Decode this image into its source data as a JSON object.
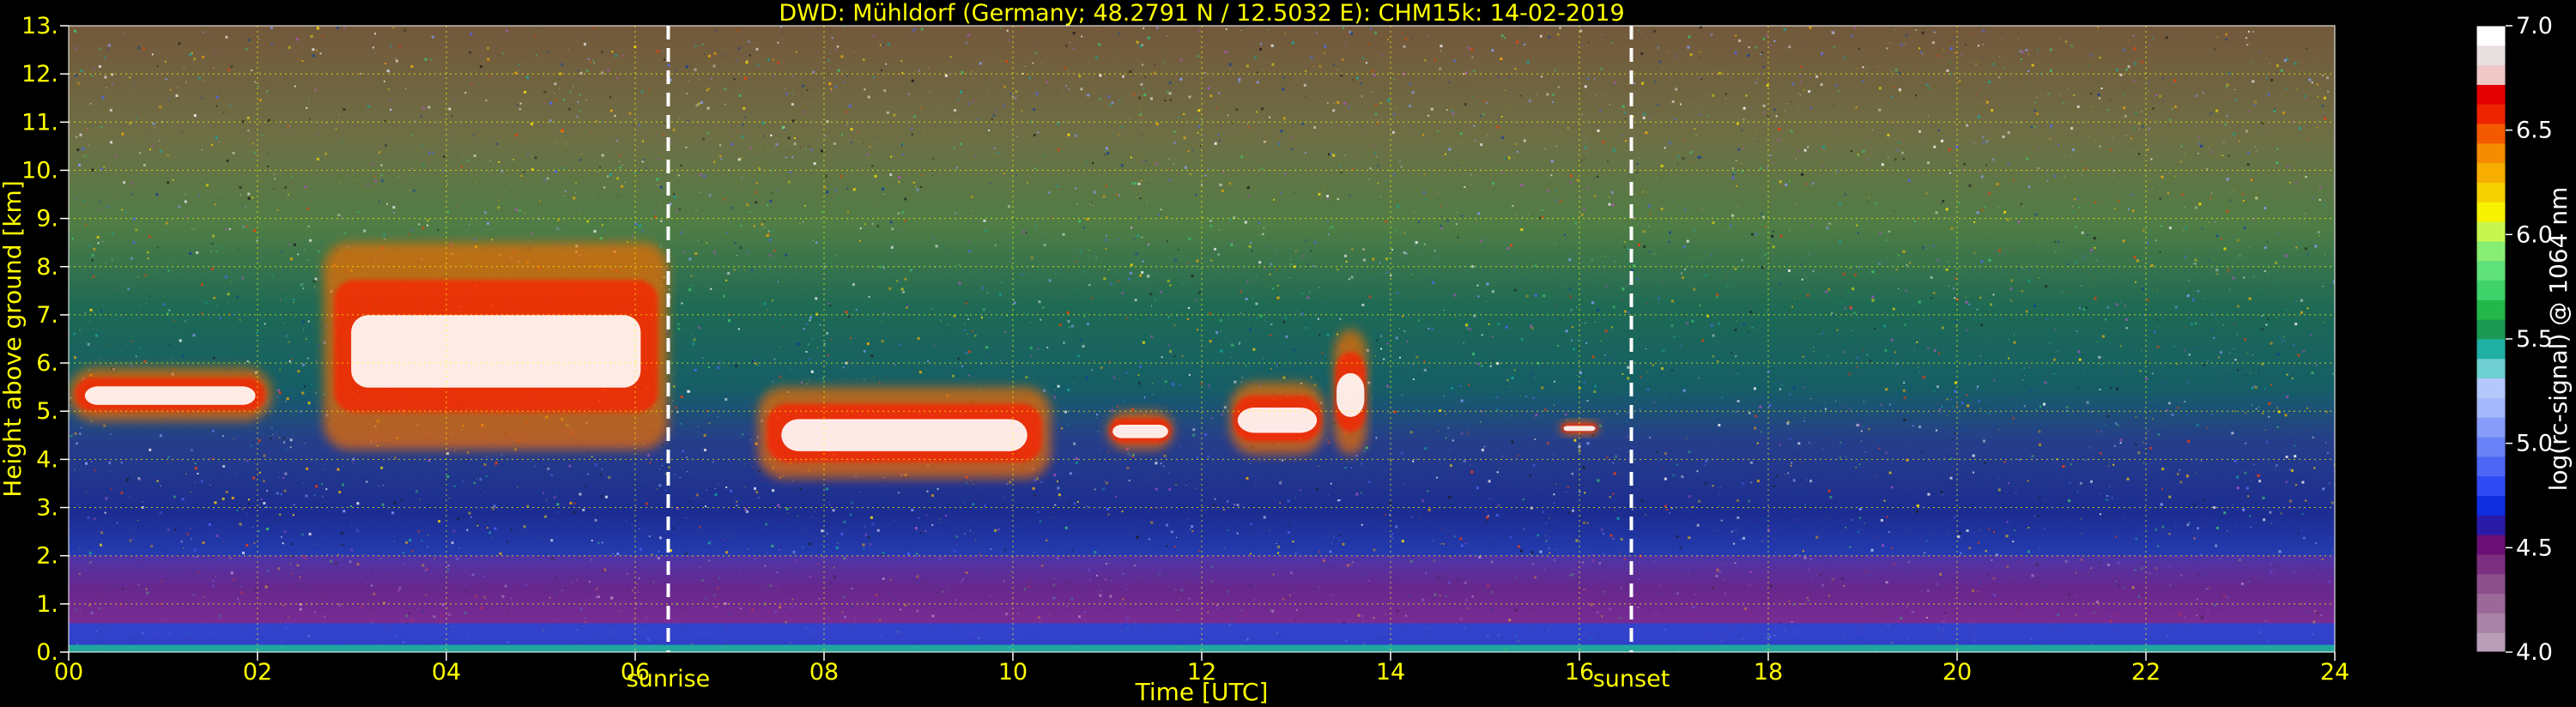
{
  "chart_data": {
    "type": "heatmap",
    "title": "DWD: Mühldorf (Germany; 48.2791 N / 12.5032 E):    CHM15k: 14-02-2019",
    "xlabel": "Time [UTC]",
    "ylabel": "Height above ground [km]",
    "xlim": [
      0,
      24
    ],
    "ylim": [
      0,
      13
    ],
    "x_ticks": [
      {
        "value": 0,
        "label": "00"
      },
      {
        "value": 2,
        "label": "02"
      },
      {
        "value": 4,
        "label": "04"
      },
      {
        "value": 6,
        "label": "06"
      },
      {
        "value": 8,
        "label": "08"
      },
      {
        "value": 10,
        "label": "10"
      },
      {
        "value": 12,
        "label": "12"
      },
      {
        "value": 14,
        "label": "14"
      },
      {
        "value": 16,
        "label": "16"
      },
      {
        "value": 18,
        "label": "18"
      },
      {
        "value": 20,
        "label": "20"
      },
      {
        "value": 22,
        "label": "22"
      },
      {
        "value": 24,
        "label": "24"
      }
    ],
    "y_ticks": [
      {
        "value": 0,
        "label": "0."
      },
      {
        "value": 1,
        "label": "1."
      },
      {
        "value": 2,
        "label": "2."
      },
      {
        "value": 3,
        "label": "3."
      },
      {
        "value": 4,
        "label": "4."
      },
      {
        "value": 5,
        "label": "5."
      },
      {
        "value": 6,
        "label": "6."
      },
      {
        "value": 7,
        "label": "7."
      },
      {
        "value": 8,
        "label": "8."
      },
      {
        "value": 9,
        "label": "9."
      },
      {
        "value": 10,
        "label": "10."
      },
      {
        "value": 11,
        "label": "11."
      },
      {
        "value": 12,
        "label": "12."
      },
      {
        "value": 13,
        "label": "13."
      }
    ],
    "grid": true,
    "annotations": [
      {
        "name": "sunrise",
        "label": "sunrise",
        "x": 6.35
      },
      {
        "name": "sunset",
        "label": "sunset",
        "x": 16.55
      }
    ],
    "colorbar": {
      "label": "log(rc-signal) @ 1064 nm",
      "range": [
        4.0,
        7.0
      ],
      "ticks": [
        {
          "value": 4.0,
          "label": "4.0"
        },
        {
          "value": 4.5,
          "label": "4.5"
        },
        {
          "value": 5.0,
          "label": "5.0"
        },
        {
          "value": 5.5,
          "label": "5.5"
        },
        {
          "value": 6.0,
          "label": "6.0"
        },
        {
          "value": 6.5,
          "label": "6.5"
        },
        {
          "value": 7.0,
          "label": "7.0"
        }
      ],
      "colors": [
        "#b89eb6",
        "#a982a8",
        "#9a6899",
        "#8a4f8b",
        "#7b2f80",
        "#6a0f75",
        "#2a1aa8",
        "#0f2ee0",
        "#2f4af2",
        "#4d66f6",
        "#6a82f7",
        "#879cf9",
        "#a5b8fb",
        "#b5c7fb",
        "#6ecfd0",
        "#1fb0a3",
        "#1a9a55",
        "#24b84a",
        "#3fd26a",
        "#5ee07a",
        "#88ee73",
        "#c8f64f",
        "#f6f200",
        "#f7d000",
        "#f7ae00",
        "#f58c00",
        "#f35a00",
        "#ee2400",
        "#e30000",
        "#f0c8c8",
        "#e8e0e0",
        "#ffffff"
      ]
    },
    "structures": {
      "boundary_layer_km": [
        0.1,
        0.6
      ],
      "residual_layer_km": [
        0.6,
        2.0
      ],
      "cloud_layers": [
        {
          "start_h": 0.0,
          "end_h": 2.15,
          "base_km": 4.8,
          "top_km": 5.9
        },
        {
          "start_h": 2.7,
          "end_h": 6.35,
          "base_km": 4.2,
          "top_km": 8.5
        },
        {
          "start_h": 7.3,
          "end_h": 10.4,
          "base_km": 3.6,
          "top_km": 5.5
        },
        {
          "start_h": 11.0,
          "end_h": 11.7,
          "base_km": 4.2,
          "top_km": 5.0
        },
        {
          "start_h": 12.3,
          "end_h": 13.3,
          "base_km": 4.1,
          "top_km": 5.6
        },
        {
          "start_h": 13.4,
          "end_h": 13.75,
          "base_km": 4.1,
          "top_km": 6.7
        },
        {
          "start_h": 15.8,
          "end_h": 16.2,
          "base_km": 4.5,
          "top_km": 4.8
        }
      ]
    }
  }
}
